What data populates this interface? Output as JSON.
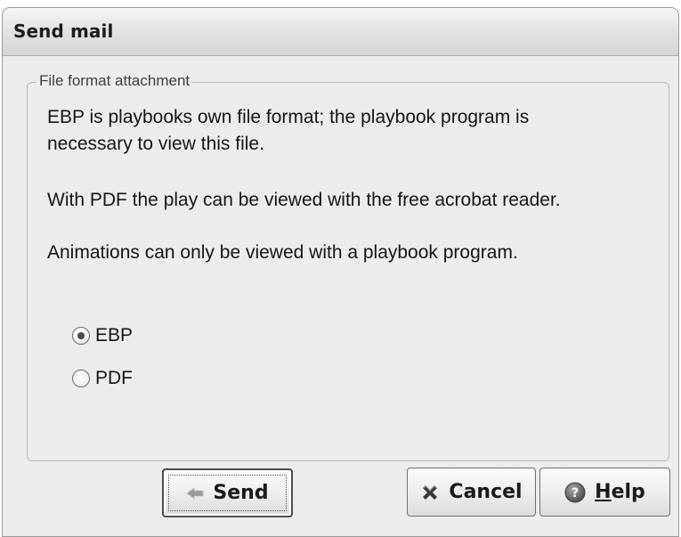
{
  "dialog": {
    "title": "Send mail"
  },
  "attachment_group": {
    "legend": "File format attachment",
    "description_lines": [
      "EBP is playbooks own file format; the playbook program is",
      "necessary to view this file.",
      "With PDF the play can be viewed with the free acrobat reader.",
      "Animations can only be viewed with a playbook program."
    ],
    "options": [
      {
        "label": "EBP",
        "selected": true
      },
      {
        "label": "PDF",
        "selected": false
      }
    ]
  },
  "buttons": {
    "send_label": "Send",
    "cancel_label": "Cancel",
    "help_mnemonic": "H",
    "help_rest": "elp",
    "send_icon": "send-arrow-icon",
    "cancel_icon": "cancel-x-icon",
    "help_icon": "help-question-icon"
  },
  "colors": {
    "dialog_bg": "#ececec",
    "titlebar_text": "#1c1c1c",
    "cancel_icon": "#3a3a3a",
    "help_icon": "#6a6a6a"
  }
}
